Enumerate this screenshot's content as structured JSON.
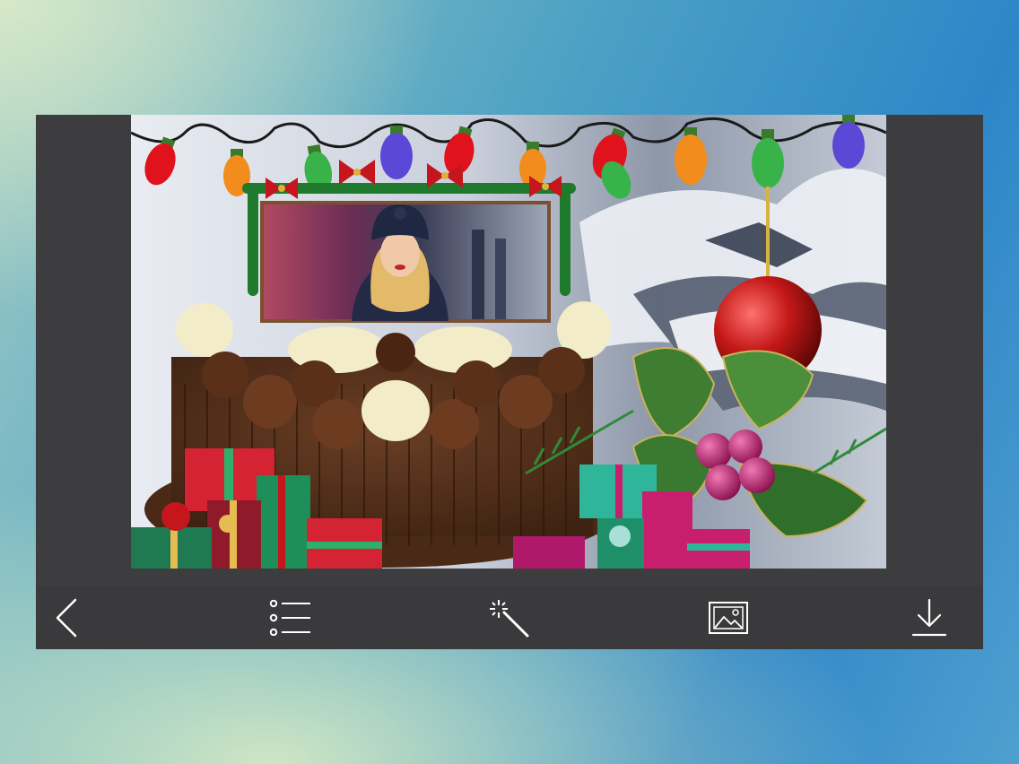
{
  "editor": {
    "frame_theme": "christmas-cake-frame",
    "photo_subject": "woman-in-winter-hat"
  },
  "toolbar": {
    "buttons": [
      {
        "id": "back",
        "icon": "chevron-left-icon",
        "label": ""
      },
      {
        "id": "frames",
        "icon": "list-icon",
        "label": ""
      },
      {
        "id": "effects",
        "icon": "magic-wand-icon",
        "label": ""
      },
      {
        "id": "gallery",
        "icon": "image-icon",
        "label": ""
      },
      {
        "id": "save",
        "icon": "download-icon",
        "label": ""
      }
    ]
  },
  "colors": {
    "panel": "#3d3d3f",
    "toolbar": "#3a3a3c",
    "icon": "#ffffff"
  }
}
